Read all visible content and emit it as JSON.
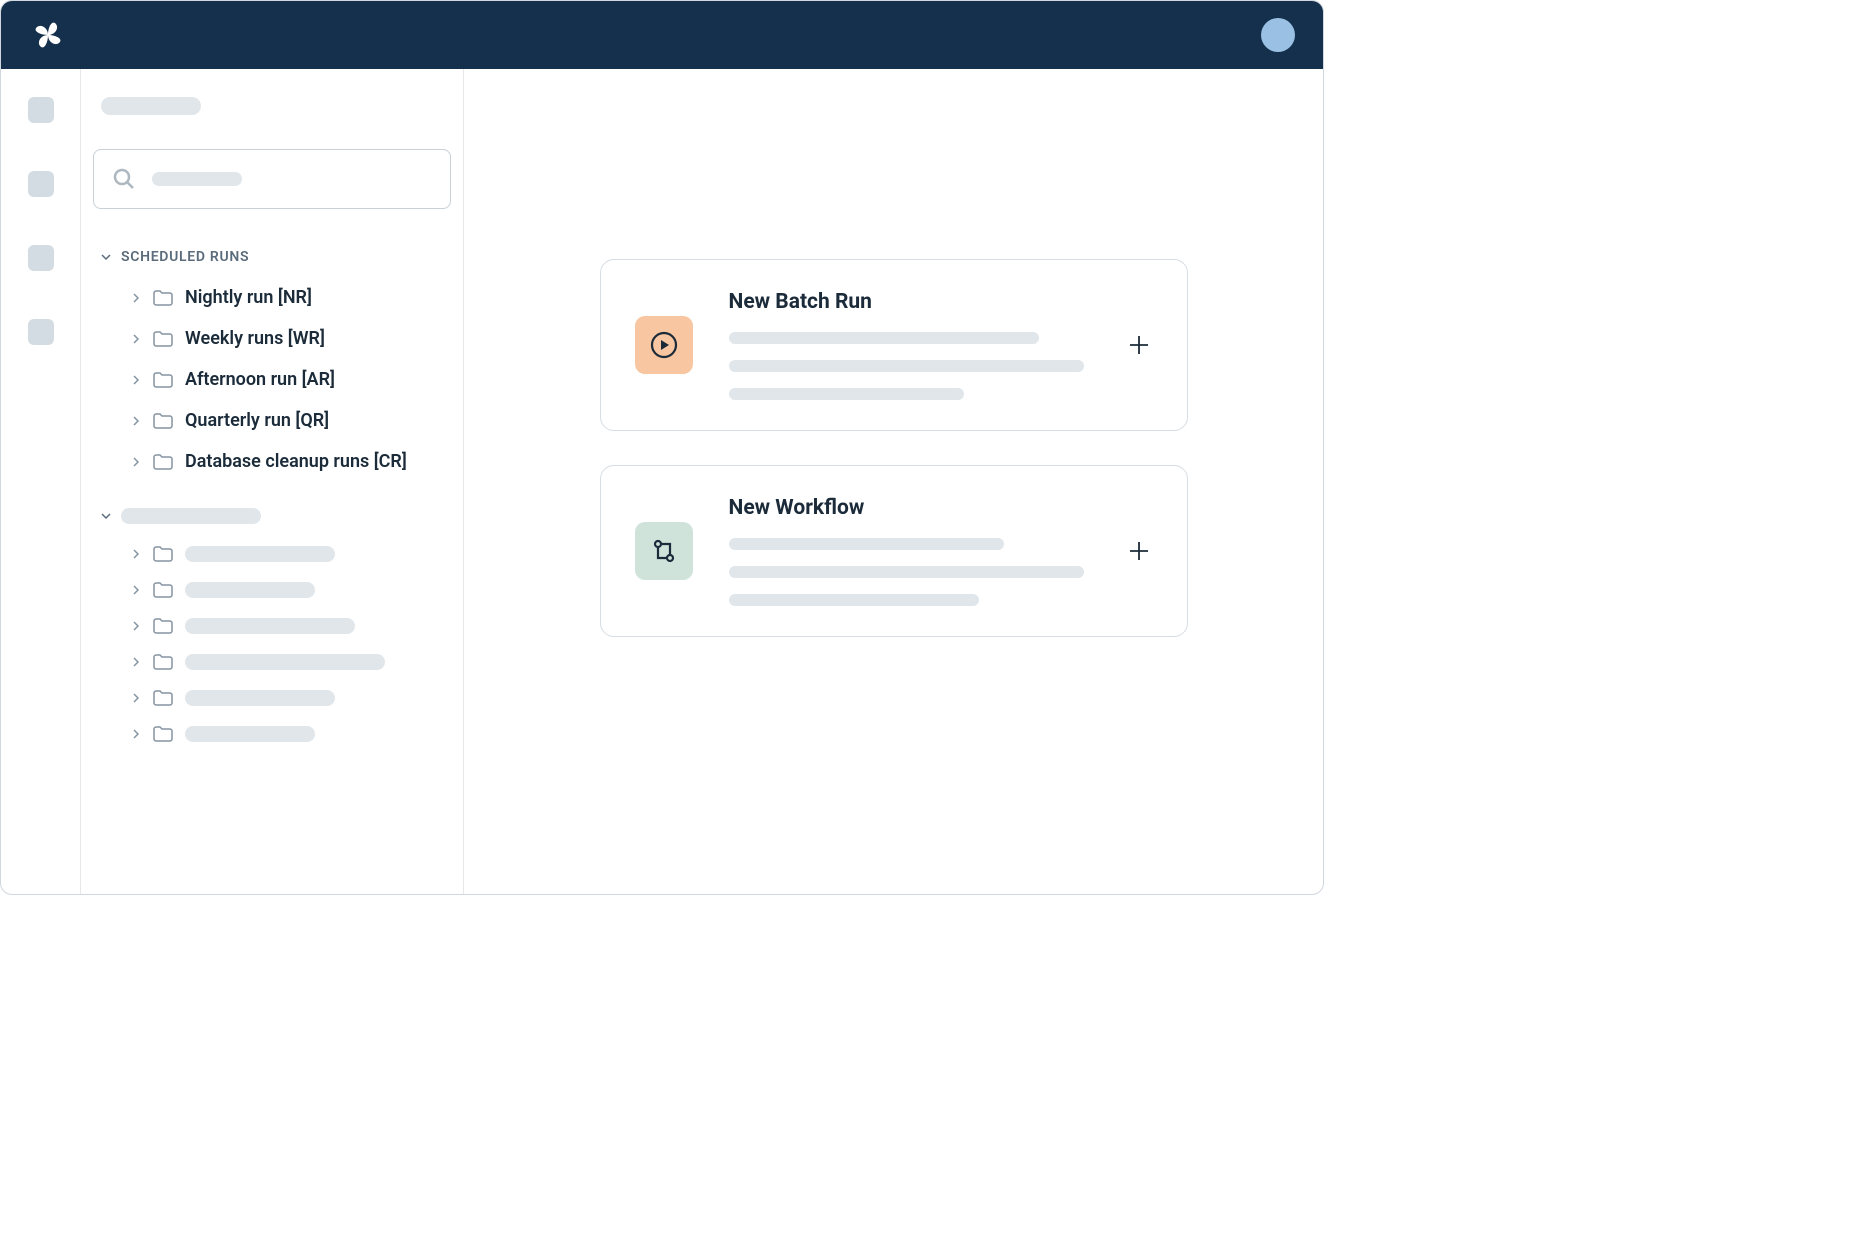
{
  "sidebar": {
    "scheduled_runs_header": "SCHEDULED RUNS",
    "scheduled_items": [
      {
        "label": "Nightly run [NR]"
      },
      {
        "label": "Weekly runs [WR]"
      },
      {
        "label": "Afternoon run [AR]"
      },
      {
        "label": "Quarterly run [QR]"
      },
      {
        "label": "Database cleanup runs [CR]"
      }
    ]
  },
  "main": {
    "cards": [
      {
        "title": "New Batch Run"
      },
      {
        "title": "New Workflow"
      }
    ]
  },
  "icons": {
    "search": "search-icon",
    "chevron_down": "chevron-down-icon",
    "chevron_right": "chevron-right-icon",
    "folder": "folder-icon",
    "play_circle": "play-circle-icon",
    "workflow": "workflow-icon",
    "plus": "plus-icon"
  },
  "colors": {
    "topbar": "#15304d",
    "avatar": "#9ac0e4",
    "card_orange": "#f8c6a0",
    "card_green": "#cfe3db"
  }
}
